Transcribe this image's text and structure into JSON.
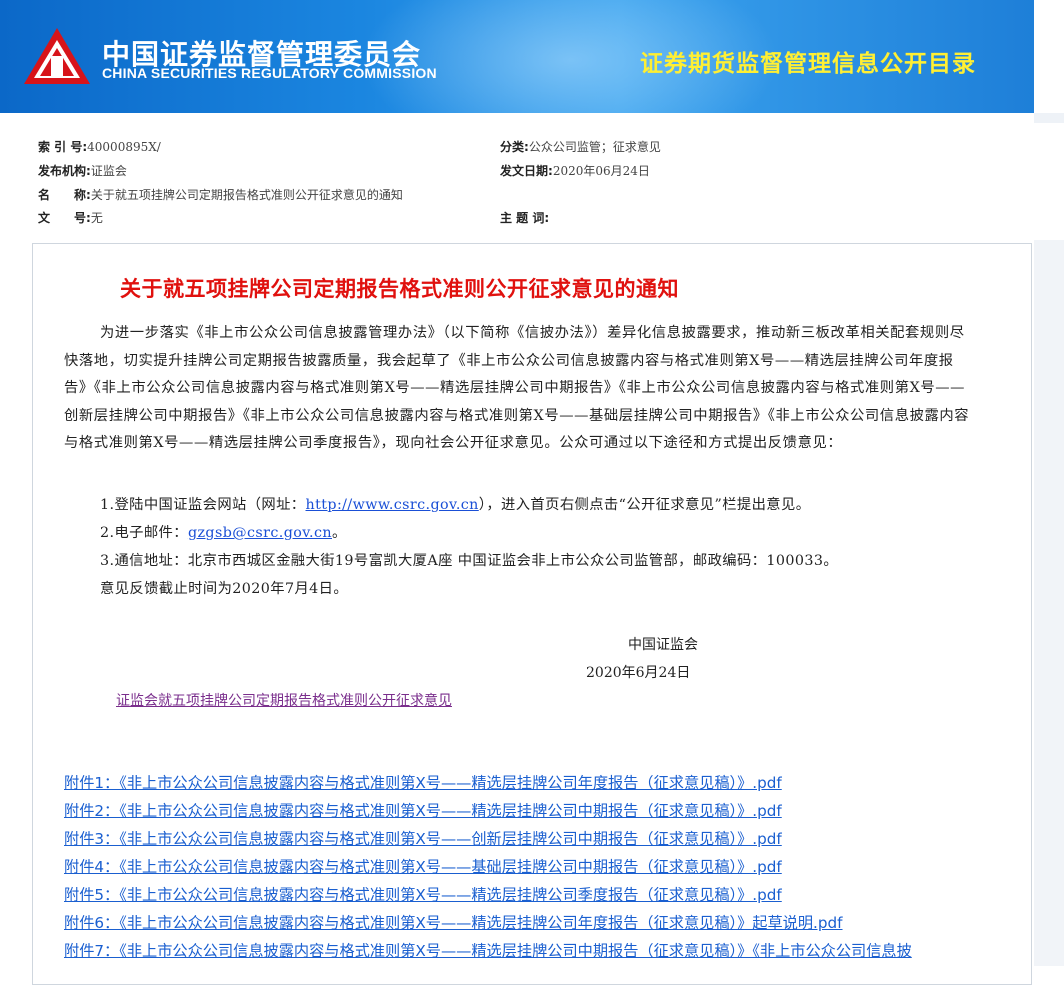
{
  "header": {
    "org_cn": "中国证券监督管理委员会",
    "org_en": "CHINA SECURITIES REGULATORY COMMISSION",
    "right_title": "证券期货监督管理信息公开目录",
    "logo_icon": "csrc-emblem-icon",
    "colors": {
      "banner": "#1b86e0",
      "title_yellow": "#ffef33",
      "logo_red": "#d7141a"
    }
  },
  "meta": {
    "index_label": "索 引 号:",
    "index_value": "40000895X/",
    "category_label": "分类:",
    "category_value": "公众公司监管；征求意见",
    "issuer_label": "发布机构:",
    "issuer_value": "证监会",
    "date_label": "发文日期:",
    "date_value": "2020年06月24日",
    "name_label": "名　　称:",
    "name_value": "关于就五项挂牌公司定期报告格式准则公开征求意见的通知",
    "docno_label": "文　　号:",
    "docno_value": "无",
    "keywords_label": "主 题 词:",
    "keywords_value": ""
  },
  "article": {
    "title": "关于就五项挂牌公司定期报告格式准则公开征求意见的通知",
    "title_color": "#e0110e",
    "paragraph": "为进一步落实《非上市公众公司信息披露管理办法》（以下简称《信披办法》）差异化信息披露要求，推动新三板改革相关配套规则尽快落地，切实提升挂牌公司定期报告披露质量，我会起草了《非上市公众公司信息披露内容与格式准则第X号——精选层挂牌公司年度报告》《非上市公众公司信息披露内容与格式准则第X号——精选层挂牌公司中期报告》《非上市公众公司信息披露内容与格式准则第X号——创新层挂牌公司中期报告》《非上市公众公司信息披露内容与格式准则第X号——基础层挂牌公司中期报告》《非上市公众公司信息披露内容与格式准则第X号——精选层挂牌公司季度报告》，现向社会公开征求意见。公众可通过以下途径和方式提出反馈意见：",
    "item1_prefix": "1.登陆中国证监会网站（网址：",
    "item1_link": "http://www.csrc.gov.cn",
    "item1_suffix": "），进入首页右侧点击“公开征求意见”栏提出意见。",
    "item2_prefix": "2.电子邮件：",
    "item2_link": "gzgsb@csrc.gov.cn",
    "item2_suffix": "。",
    "item3": "3.通信地址：北京市西城区金融大街19号富凯大厦A座 中国证监会非上市公众公司监管部，邮政编码：100033。",
    "deadline": "意见反馈截止时间为2020年7月4日。",
    "signer": "中国证监会",
    "sign_date": "2020年6月24日",
    "related_link": "证监会就五项挂牌公司定期报告格式准则公开征求意见"
  },
  "attachments": [
    "附件1：《非上市公众公司信息披露内容与格式准则第X号——精选层挂牌公司年度报告（征求意见稿）》.pdf",
    "附件2：《非上市公众公司信息披露内容与格式准则第X号——精选层挂牌公司中期报告（征求意见稿）》.pdf",
    "附件3：《非上市公众公司信息披露内容与格式准则第X号——创新层挂牌公司中期报告（征求意见稿）》.pdf",
    "附件4：《非上市公众公司信息披露内容与格式准则第X号——基础层挂牌公司中期报告（征求意见稿）》.pdf",
    "附件5：《非上市公众公司信息披露内容与格式准则第X号——精选层挂牌公司季度报告（征求意见稿）》.pdf",
    "附件6：《非上市公众公司信息披露内容与格式准则第X号——精选层挂牌公司年度报告（征求意见稿）》起草说明.pdf",
    "附件7：《非上市公众公司信息披露内容与格式准则第X号——精选层挂牌公司中期报告（征求意见稿）》《非上市公众公司信息披"
  ]
}
